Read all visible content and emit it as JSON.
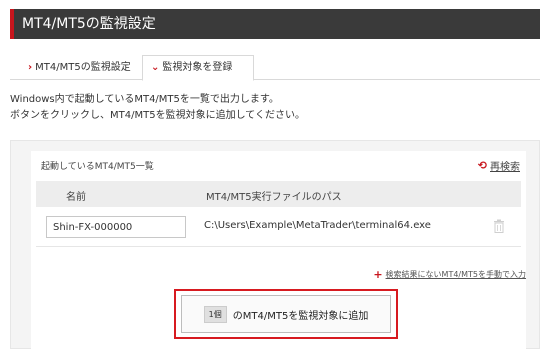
{
  "header": {
    "title": "MT4/MT5の監視設定"
  },
  "tabs": [
    {
      "label": "MT4/MT5の監視設定",
      "icon": "chevron-right-icon"
    },
    {
      "label": "監視対象を登録",
      "icon": "chevron-down-icon"
    }
  ],
  "description": {
    "line1": "Windows内で起動しているMT4/MT5を一覧で出力します。",
    "line2": "ボタンをクリックし、MT4/MT5を監視対象に追加してください。"
  },
  "list": {
    "title": "起動しているMT4/MT5一覧",
    "rescan_label": "再検索",
    "columns": {
      "name": "名前",
      "path": "MT4/MT5実行ファイルのパス"
    },
    "rows": [
      {
        "name": "Shin-FX-000000",
        "path": "C:\\Users\\Example\\MetaTrader\\terminal64.exe"
      }
    ],
    "manual_link": "検索結果にないMT4/MT5を手動で入力"
  },
  "add_button": {
    "count": "1個",
    "label": "のMT4/MT5を監視対象に追加"
  },
  "colors": {
    "accent": "#c8161d",
    "header_bg": "#3a3a3a"
  }
}
